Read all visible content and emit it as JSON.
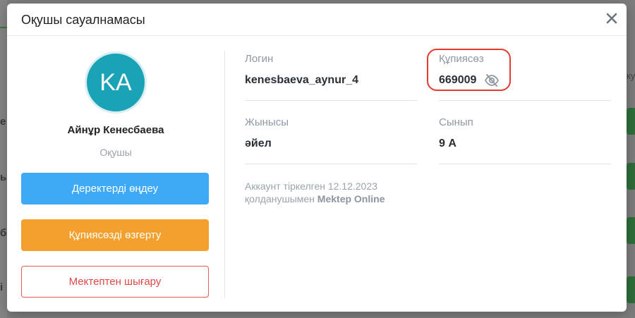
{
  "modal": {
    "title": "Оқушы сауалнамасы",
    "close_icon": "close-icon"
  },
  "profile": {
    "initials": "KA",
    "avatar_color": "#1aa3b6",
    "name": "Айнұр Кенесбаева",
    "role": "Оқушы"
  },
  "actions": {
    "edit_label": "Деректерді өңдеу",
    "change_password_label": "Құпиясөзді өзгерту",
    "remove_label": "Мектептен шығару"
  },
  "fields": {
    "login_label": "Логин",
    "login_value": "kenesbaeva_aynur_4",
    "password_label": "Құпиясөз",
    "password_value": "669009",
    "gender_label": "Жынысы",
    "gender_value": "әйел",
    "class_label": "Сынып",
    "class_value": "9 А"
  },
  "registration": {
    "line1": "Аккаунт тіркелген 12.12.2023",
    "line2_prefix": "қолданушымен",
    "line2_user": "Mektep Online"
  },
  "background": {
    "left_fragments": [
      "е",
      "ь",
      "б",
      "і"
    ],
    "right_fragments": [
      "ку"
    ]
  },
  "colors": {
    "primary": "#3eaaf6",
    "warning": "#f3a02f",
    "danger": "#e04848",
    "highlight": "#e43a2f"
  }
}
